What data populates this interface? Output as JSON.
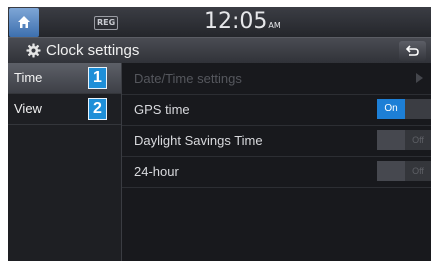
{
  "status_bar": {
    "reg_badge": "REG",
    "time": "12:05",
    "ampm": "AM",
    "home_icon": "home-icon"
  },
  "header": {
    "title": "Clock settings",
    "settings_icon": "gear-icon",
    "back_icon": "back-arrow-icon"
  },
  "sidebar": {
    "items": [
      {
        "label": "Time",
        "badge": "1",
        "selected": true
      },
      {
        "label": "View",
        "badge": "2",
        "selected": false
      }
    ]
  },
  "settings": {
    "rows": [
      {
        "label": "Date/Time settings",
        "enabled": false,
        "control": "chevron"
      },
      {
        "label": "GPS time",
        "enabled": true,
        "control": "toggle",
        "state": "On",
        "on_text": "On",
        "off_text": ""
      },
      {
        "label": "Daylight Savings Time",
        "enabled": true,
        "control": "toggle",
        "state": "Off",
        "on_text": "",
        "off_text": "Off"
      },
      {
        "label": "24-hour",
        "enabled": true,
        "control": "toggle",
        "state": "Off",
        "on_text": "",
        "off_text": "Off"
      }
    ]
  },
  "colors": {
    "accent": "#1d7fd6",
    "badge": "#1e8fd8",
    "background": "#141518"
  }
}
